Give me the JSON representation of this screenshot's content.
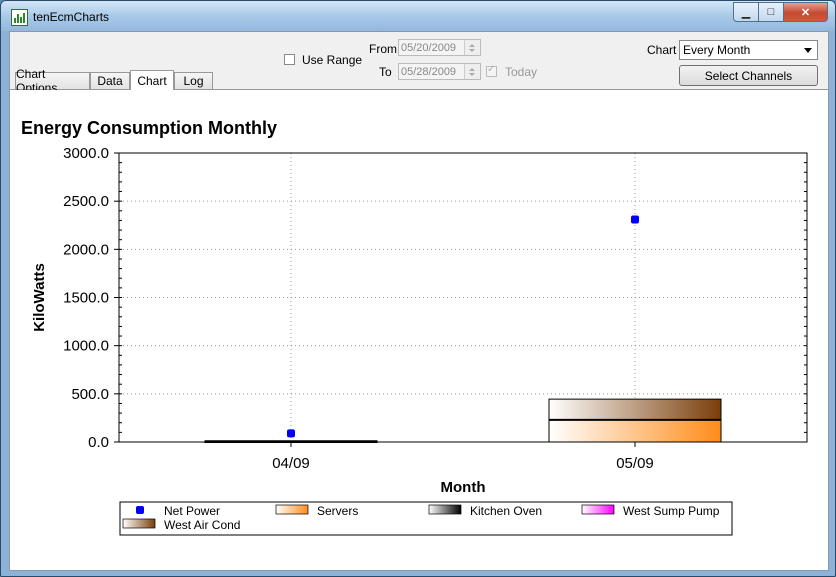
{
  "window": {
    "title": "tenEcmCharts"
  },
  "tabs": [
    {
      "label": "Chart Options"
    },
    {
      "label": "Data"
    },
    {
      "label": "Chart"
    },
    {
      "label": "Log"
    }
  ],
  "range": {
    "use_range_label": "Use Range",
    "from_label": "From",
    "from_value": "05/20/2009",
    "to_label": "To",
    "to_value": "05/28/2009",
    "today_label": "Today"
  },
  "chart_select": {
    "label": "Chart",
    "value": "Every Month"
  },
  "select_channels_label": "Select Channels",
  "colors": {
    "accent": "#0000ff",
    "orange": "#ff8c1a",
    "brown": "#8b4a10"
  },
  "chart_data": {
    "type": "bar",
    "title": "Energy Consumption Monthly",
    "xlabel": "Month",
    "ylabel": "KiloWatts",
    "ylim": [
      0,
      3000
    ],
    "yticks": [
      "0.0",
      "500.0",
      "1000.0",
      "1500.0",
      "2000.0",
      "2500.0",
      "3000.0"
    ],
    "categories": [
      "04/09",
      "05/09"
    ],
    "stacked_series": [
      {
        "name": "Servers",
        "values": [
          5,
          230
        ],
        "gradient": [
          "#ffffff",
          "#ff8c1a"
        ]
      },
      {
        "name": "Kitchen Oven",
        "values": [
          0,
          5
        ],
        "gradient": [
          "#ffffff",
          "#000000"
        ]
      },
      {
        "name": "West Sump Pump",
        "values": [
          0,
          0
        ],
        "gradient": [
          "#ffffff",
          "#ff00ff"
        ]
      },
      {
        "name": "West Air Cond",
        "values": [
          8,
          210
        ],
        "gradient": [
          "#ffffff",
          "#7a3e0a"
        ]
      }
    ],
    "point_series": [
      {
        "name": "Net Power",
        "values": [
          90,
          2310
        ],
        "color": "#0000ff"
      }
    ],
    "legend": [
      "Net Power",
      "Servers",
      "Kitchen Oven",
      "West Sump Pump",
      "West Air Cond"
    ],
    "legend_placement": "bottom",
    "grid": true
  }
}
